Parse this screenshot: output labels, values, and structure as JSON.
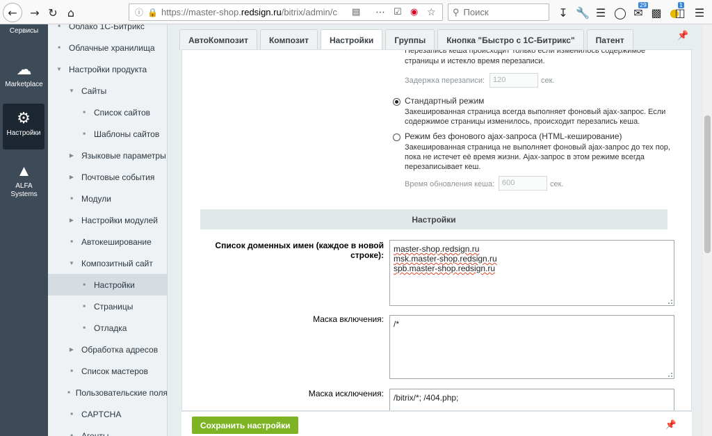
{
  "browser": {
    "url_prefix": "https://master-shop.",
    "url_domain": "redsign.ru",
    "url_path": "/bitrix/admin/c",
    "search_placeholder": "Поиск",
    "notification_badge": "29",
    "extra_badge": "1"
  },
  "admin_menu": [
    {
      "label": "Сервисы",
      "icon": "services-icon"
    },
    {
      "label": "Marketplace",
      "icon": "cloud-download-icon"
    },
    {
      "label": "Настройки",
      "icon": "gear-icon"
    },
    {
      "label": "ALFA Systems",
      "icon": "alfa-logo-icon"
    }
  ],
  "tree": [
    {
      "label": "Облако 1С-Битрикс",
      "marker": "bullet"
    },
    {
      "label": "Облачные хранилища",
      "marker": "bullet"
    },
    {
      "label": "Настройки продукта",
      "marker": "open"
    },
    {
      "label": "Сайты",
      "marker": "open"
    },
    {
      "label": "Список сайтов",
      "marker": "bullet"
    },
    {
      "label": "Шаблоны сайтов",
      "marker": "bullet"
    },
    {
      "label": "Языковые параметры",
      "marker": "closed"
    },
    {
      "label": "Почтовые события",
      "marker": "closed"
    },
    {
      "label": "Модули",
      "marker": "bullet"
    },
    {
      "label": "Настройки модулей",
      "marker": "closed"
    },
    {
      "label": "Автокеширование",
      "marker": "bullet"
    },
    {
      "label": "Композитный сайт",
      "marker": "open"
    },
    {
      "label": "Настройки",
      "marker": "bullet"
    },
    {
      "label": "Страницы",
      "marker": "bullet"
    },
    {
      "label": "Отладка",
      "marker": "bullet"
    },
    {
      "label": "Обработка адресов",
      "marker": "closed"
    },
    {
      "label": "Список мастеров",
      "marker": "bullet"
    },
    {
      "label": "Пользовательские поля",
      "marker": "bullet"
    },
    {
      "label": "CAPTCHA",
      "marker": "bullet"
    },
    {
      "label": "Агенты",
      "marker": "bullet"
    }
  ],
  "tabs": [
    {
      "label": "АвтоКомпозит"
    },
    {
      "label": "Композит"
    },
    {
      "label": "Настройки"
    },
    {
      "label": "Группы"
    },
    {
      "label": "Кнопка \"Быстро с 1С-Битрикс\""
    },
    {
      "label": "Патент"
    }
  ],
  "content": {
    "top_text_1": "Перезапись кеша происходит только если изменилось содержимое",
    "top_text_2": "страницы и истекло время перезаписи.",
    "delay_label": "Задержка перезаписи:",
    "delay_value": "120",
    "delay_unit": "сек.",
    "mode1_label": "Стандартный режим",
    "mode1_desc_1": "Закешированная страница всегда выполняет фоновый ajax-запрос. Если",
    "mode1_desc_2": "содержимое страницы изменилось, происходит перезапись кеша.",
    "mode2_label": "Режим без фонового ajax-запроса (HTML-кеширование)",
    "mode2_desc_1": "Закешированная страница не выполняет фоновый ajax-запрос до тех пор,",
    "mode2_desc_2": "пока не истечет её время жизни. Ajax-запрос в этом режиме всегда",
    "mode2_desc_3": "перезаписывает кеш.",
    "refresh_label": "Время обновления кеша:",
    "refresh_value": "600",
    "refresh_unit": "сек.",
    "section_title": "Настройки",
    "domains_label_1": "Список доменных имен (каждое в новой",
    "domains_label_2": "строке):",
    "domains": [
      "master-shop.redsign.ru",
      "msk.master-shop.redsign.ru",
      "spb.master-shop.redsign.ru"
    ],
    "include_label": "Маска включения:",
    "include_value": "/*",
    "exclude_label": "Маска исключения:",
    "exclude_value": "/bitrix/*; /404.php;"
  },
  "footer": {
    "save_label": "Сохранить настройки"
  },
  "colors": {
    "admin_menu_bg": "#3d4a58",
    "save_button": "#7eb424"
  }
}
